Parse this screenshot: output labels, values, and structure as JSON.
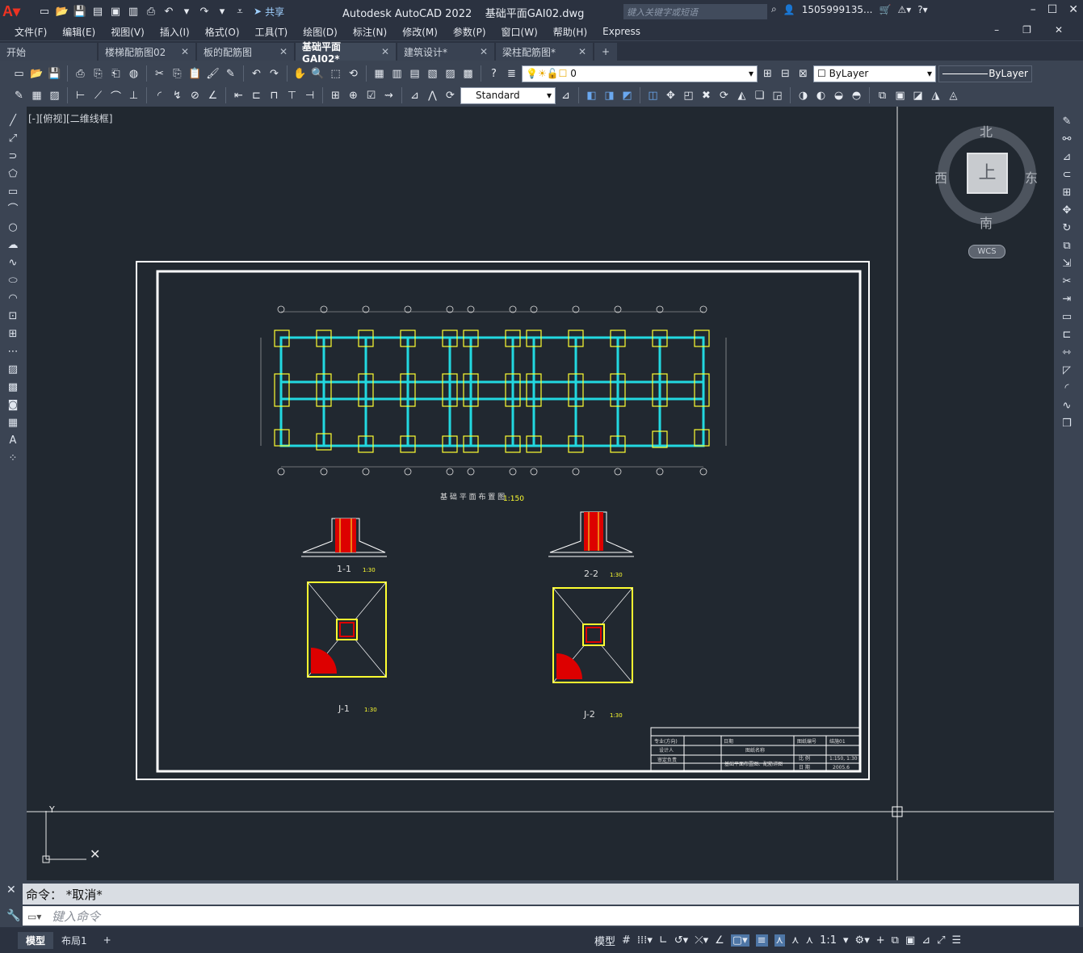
{
  "app": {
    "title": "Autodesk AutoCAD 2022",
    "filename": "基础平面GAI02.dwg",
    "search_placeholder": "键入关键字或短语",
    "user": "1505999135...",
    "share": "共享",
    "logo": "A"
  },
  "menu": [
    "文件(F)",
    "编辑(E)",
    "视图(V)",
    "插入(I)",
    "格式(O)",
    "工具(T)",
    "绘图(D)",
    "标注(N)",
    "修改(M)",
    "参数(P)",
    "窗口(W)",
    "帮助(H)",
    "Express"
  ],
  "tabs": [
    {
      "label": "开始",
      "close": false
    },
    {
      "label": "楼梯配筋图02",
      "close": true
    },
    {
      "label": "板的配筋图",
      "close": true
    },
    {
      "label": "基础平面GAI02*",
      "close": true,
      "active": true
    },
    {
      "label": "建筑设计*",
      "close": true
    },
    {
      "label": "梁柱配筋图*",
      "close": true
    }
  ],
  "toolbar": {
    "layer": "0",
    "color": "ByLayer",
    "linetype": "ByLayer",
    "textstyle": "Standard"
  },
  "view": {
    "label": "[-][俯视][二维线框]",
    "north": "北",
    "south": "南",
    "east": "东",
    "west": "西",
    "top_face": "上",
    "wcs": "WCS"
  },
  "drawing": {
    "plan_title": "基 础 平 面 布 置 图",
    "plan_scale": "1:150",
    "sec1": "1-1",
    "sec2": "2-2",
    "secscale": "1:30",
    "j1": "J-1",
    "j2": "J-2",
    "tb": {
      "r1": "专业(方向)",
      "r2": "设计人",
      "r3": "审定负责",
      "c1": "日期",
      "c2": "图纸名称",
      "c3": "基础平面布置图、配筋详图",
      "no": "图纸编号",
      "scale": "比 例",
      "date": "日 期",
      "v_no": "结施01",
      "v_scale": "1:150, 1:30",
      "v_date": "2005.6"
    }
  },
  "command": {
    "history": "命令： *取消*",
    "placeholder": "键入命令"
  },
  "status": {
    "model": "模型",
    "layout": "布局1",
    "mode": "模型",
    "scale": "1:1"
  }
}
